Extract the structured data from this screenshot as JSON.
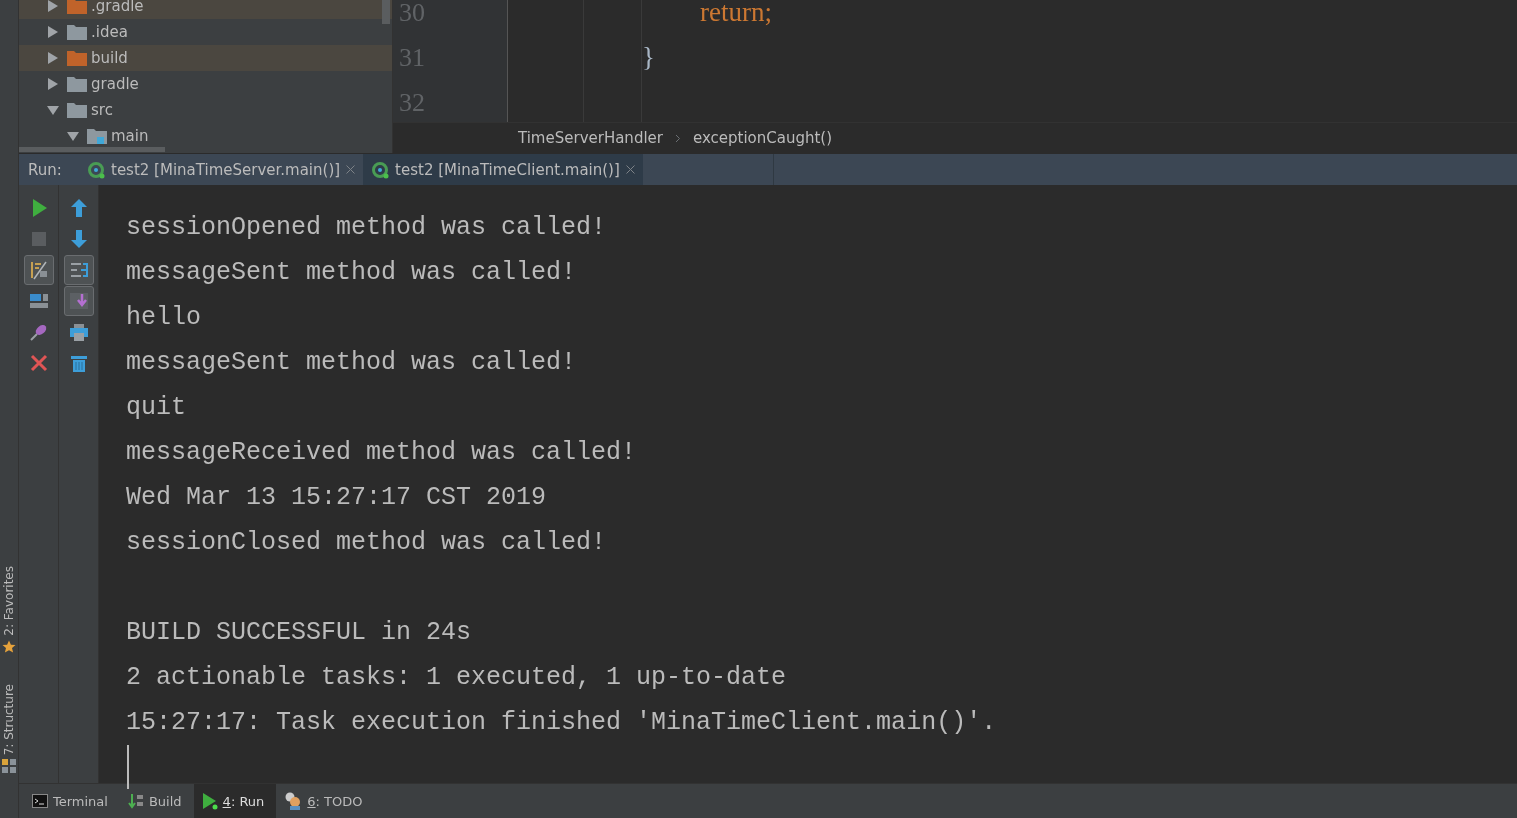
{
  "project_tree": {
    "items": [
      {
        "label": ".gradle",
        "excluded": true,
        "expanded": false
      },
      {
        "label": ".idea",
        "excluded": false,
        "expanded": false
      },
      {
        "label": "build",
        "excluded": true,
        "expanded": false
      },
      {
        "label": "gradle",
        "excluded": false,
        "expanded": false
      },
      {
        "label": "src",
        "excluded": false,
        "expanded": true,
        "children": [
          {
            "label": "main",
            "excluded": false,
            "expanded": true,
            "kind": "source"
          }
        ]
      }
    ]
  },
  "editor": {
    "lines": [
      {
        "number": "30",
        "code": "return;",
        "kind": "keyword"
      },
      {
        "number": "31",
        "code": "}",
        "kind": "brace"
      },
      {
        "number": "32",
        "kind": "empty"
      }
    ],
    "breadcrumbs": [
      "TimeServerHandler",
      "exceptionCaught()"
    ]
  },
  "run_panel": {
    "title": "Run:",
    "tabs": [
      {
        "label": "test2 [MinaTimeServer.main()]",
        "selected": false
      },
      {
        "label": "test2 [MinaTimeClient.main()]",
        "selected": true
      }
    ],
    "toolbar_left": [
      {
        "kind": "run",
        "toggled": false
      },
      {
        "kind": "stop",
        "toggled": false
      },
      {
        "kind": "softwrap",
        "toggled": true
      },
      {
        "kind": "layout",
        "toggled": false
      },
      {
        "kind": "pin",
        "toggled": false
      },
      {
        "kind": "close",
        "toggled": false
      }
    ],
    "toolbar_right": [
      {
        "kind": "up",
        "toggled": false
      },
      {
        "kind": "down",
        "toggled": false
      },
      {
        "kind": "wrap",
        "toggled": true
      },
      {
        "kind": "scrollend",
        "toggled": true
      },
      {
        "kind": "print",
        "toggled": false
      },
      {
        "kind": "trash",
        "toggled": false
      }
    ],
    "console_blocks": [
      [
        "sessionOpened method was called!",
        "messageSent method was called!",
        "hello",
        "messageSent method was called!",
        "quit",
        "messageReceived method was called!",
        "Wed Mar 13 15:27:17 CST 2019",
        "sessionClosed method was called!"
      ],
      [
        "BUILD SUCCESSFUL in 24s",
        "2 actionable tasks: 1 executed, 1 up-to-date",
        "15:27:17: Task execution finished 'MinaTimeClient.main()'."
      ]
    ]
  },
  "side_stripe": [
    {
      "label": "2: Favorites",
      "kind": "favorites"
    },
    {
      "label": "7: Structure",
      "kind": "structure"
    }
  ],
  "bottom_tools": [
    {
      "kind": "terminal",
      "label": "Terminal",
      "selected": false
    },
    {
      "kind": "build",
      "label": "Build",
      "selected": false
    },
    {
      "kind": "run",
      "mnemonic": "4",
      "label": ": Run",
      "selected": true
    },
    {
      "kind": "todo",
      "mnemonic": "6",
      "label": ": TODO",
      "selected": false
    }
  ]
}
